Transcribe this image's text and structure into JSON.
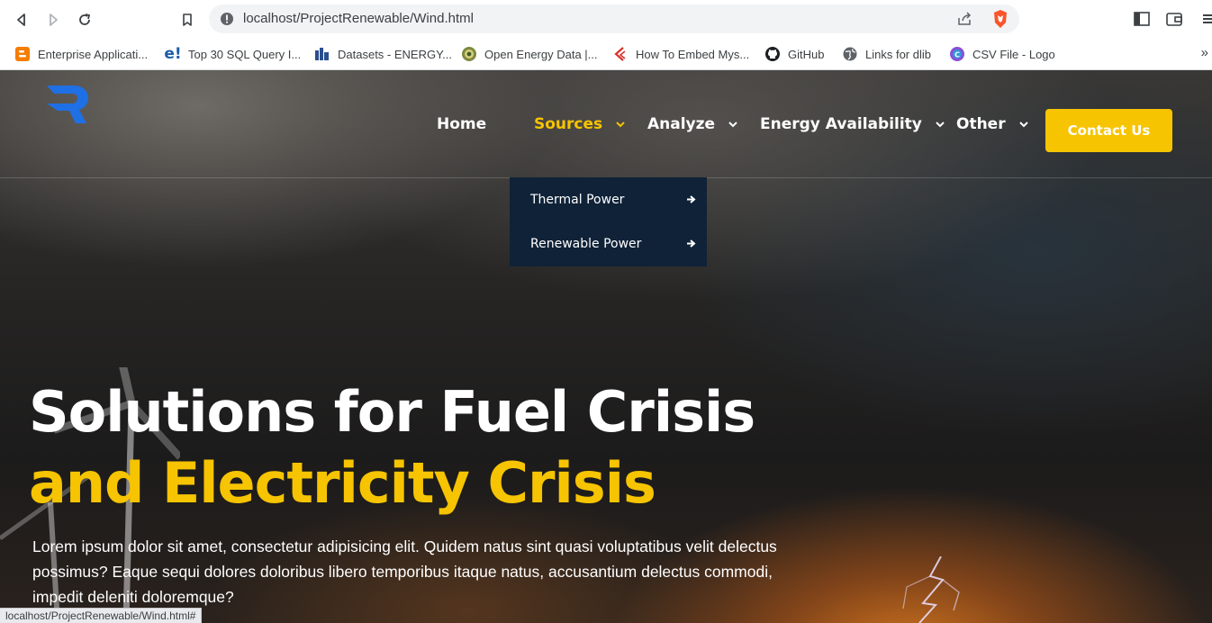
{
  "browser": {
    "url": "localhost/ProjectRenewable/Wind.html",
    "status_url": "localhost/ProjectRenewable/Wind.html#",
    "bookmarks": [
      {
        "label": "Enterprise Applicati...",
        "icon": "blogger-icon"
      },
      {
        "label": "Top 30 SQL Query I...",
        "icon": "edureka-icon"
      },
      {
        "label": "Datasets - ENERGY...",
        "icon": "energy-data-icon"
      },
      {
        "label": "Open Energy Data |...",
        "icon": "open-energy-icon"
      },
      {
        "label": "How To Embed Mys...",
        "icon": "tutorial-site-icon"
      },
      {
        "label": "GitHub",
        "icon": "github-icon"
      },
      {
        "label": "Links for dlib",
        "icon": "globe-icon"
      },
      {
        "label": "CSV File - Logo",
        "icon": "csv-logo-icon"
      }
    ],
    "more_bookmarks": "»"
  },
  "site": {
    "nav": [
      {
        "label": "Home",
        "has_dropdown": false
      },
      {
        "label": "Sources",
        "has_dropdown": true,
        "active": true
      },
      {
        "label": "Analyze",
        "has_dropdown": true
      },
      {
        "label": "Energy Availability",
        "has_dropdown": true
      },
      {
        "label": "Other",
        "has_dropdown": true
      }
    ],
    "contact_label": "Contact Us",
    "sources_menu": [
      {
        "label": "Thermal Power"
      },
      {
        "label": "Renewable Power"
      }
    ],
    "colors": {
      "accent": "#f6c400",
      "dropdown_bg": "#0f2238",
      "logo_blue": "#1f6fe5"
    }
  },
  "hero": {
    "headline_line1": "Solutions for Fuel Crisis",
    "headline_line2": "and Electricity Crisis",
    "lede": "Lorem ipsum dolor sit amet, consectetur adipisicing elit. Quidem natus sint quasi voluptatibus velit delectus possimus? Eaque sequi dolores doloribus libero temporibus itaque natus, accusantium delectus commodi, impedit deleniti doloremque?"
  }
}
